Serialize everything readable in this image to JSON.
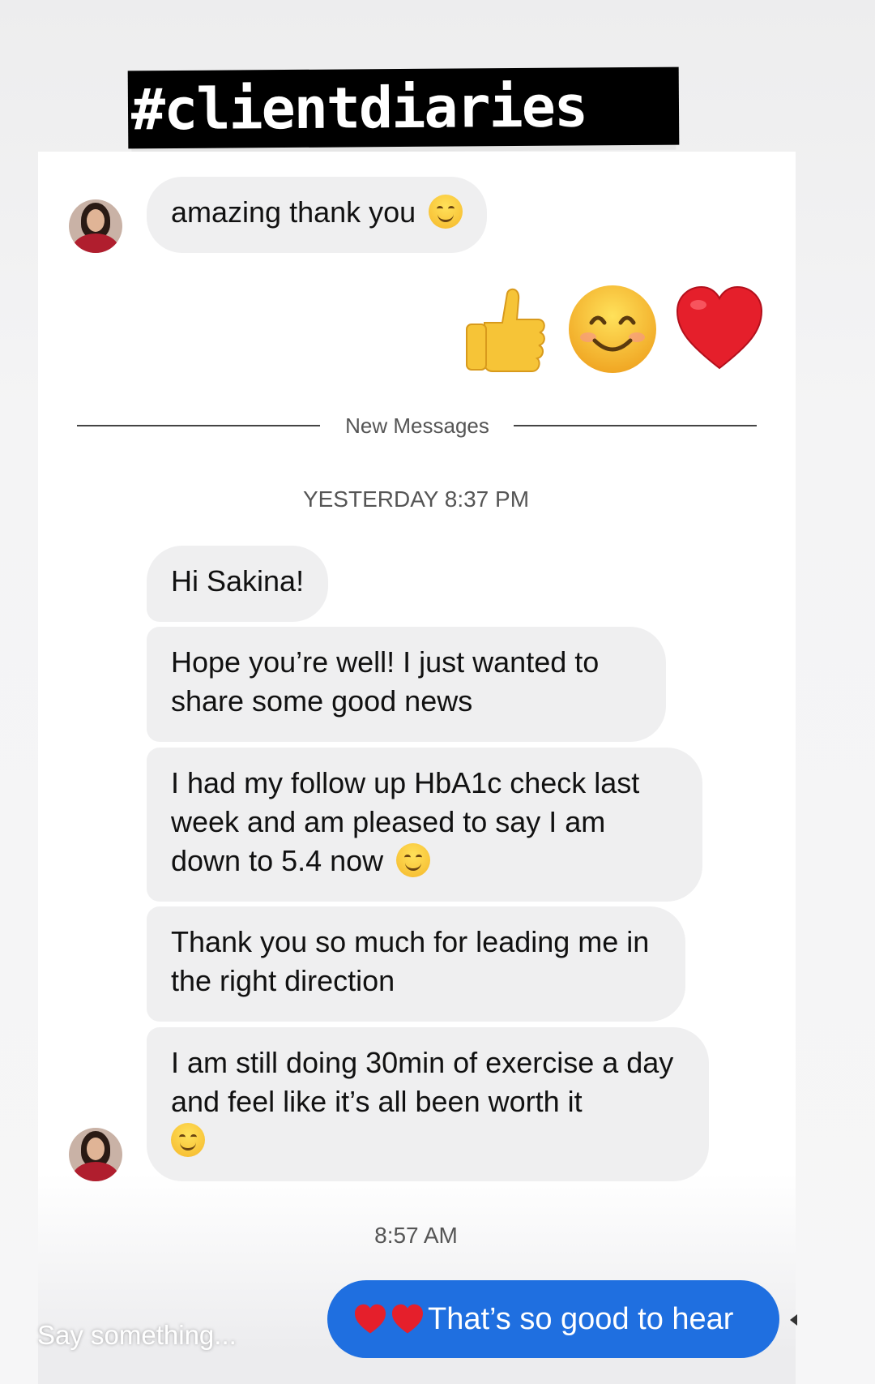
{
  "sticker": {
    "text": "#clientdiaries"
  },
  "thread": {
    "earlier": {
      "received_text": "amazing thank you",
      "received_emoji": "grinning-face",
      "sent_reaction_emojis": [
        "thumbs-up",
        "smiling-face-with-smiling-eyes",
        "red-heart"
      ]
    },
    "new_messages_label": "New Messages",
    "timestamp_1": "YESTERDAY 8:37 PM",
    "messages": [
      "Hi Sakina!",
      "Hope you’re well! I just wanted to share some good news",
      "I had my follow up HbA1c check last week and am pleased to say I am down to 5.4 now",
      "Thank you so much for leading me in the right direction",
      "I am still doing 30min of exercise a day and feel like it’s all been worth it"
    ],
    "timestamp_2": "8:57 AM",
    "reply": {
      "text": "That’s so good to hear",
      "prefix_emojis": [
        "red-heart",
        "red-heart"
      ]
    }
  },
  "composer": {
    "placeholder": "Say something..."
  },
  "colors": {
    "sent_bubble": "#1f6fe0",
    "received_bubble": "#efeff0",
    "sticker_bg": "#000000"
  }
}
